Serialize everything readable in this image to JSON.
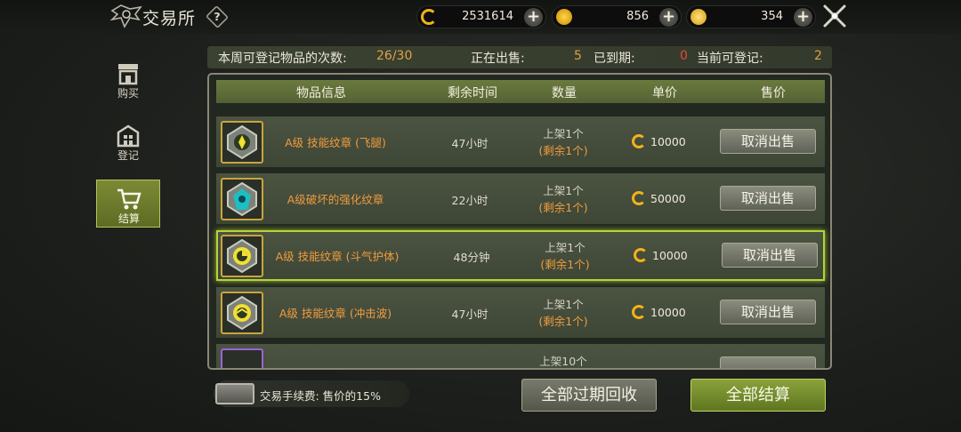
{
  "header": {
    "title": "交易所",
    "help_label": "?",
    "currencies": [
      {
        "name": "coin-currency",
        "value": "2531614",
        "add_label": "+"
      },
      {
        "name": "gold-currency",
        "value": "856",
        "add_label": "+"
      },
      {
        "name": "gem-currency",
        "value": "354",
        "add_label": "+"
      }
    ]
  },
  "sidebar": {
    "items": [
      {
        "label": "购买",
        "icon": "shop-icon"
      },
      {
        "label": "登记",
        "icon": "register-icon"
      },
      {
        "label": "结算",
        "icon": "cart-icon",
        "active": true
      }
    ]
  },
  "stats": {
    "weekly_label": "本周可登记物品的次数:",
    "weekly_value": "26/30",
    "selling_label": "正在出售:",
    "selling_value": "5",
    "expired_label": "已到期:",
    "expired_value": "0",
    "registerable_label": "当前可登记:",
    "registerable_value": "2"
  },
  "table": {
    "headers": [
      "物品信息",
      "剩余时间",
      "数量",
      "单价",
      "售价"
    ],
    "rows": [
      {
        "name": "A级 技能纹章 (飞腿)",
        "time": "47小时",
        "qty": "上架1个",
        "remain": "(剩余1个)",
        "price": "10000",
        "action": "取消出售",
        "icon": "emblem-icon"
      },
      {
        "name": "A级破坏的强化纹章",
        "time": "22小时",
        "qty": "上架1个",
        "remain": "(剩余1个)",
        "price": "50000",
        "action": "取消出售",
        "icon": "emblem-icon"
      },
      {
        "name": "A级 技能纹章 (斗气护体)",
        "time": "48分钟",
        "qty": "上架1个",
        "remain": "(剩余1个)",
        "price": "10000",
        "action": "取消出售",
        "icon": "emblem-icon"
      },
      {
        "name": "A级 技能纹章 (冲击波)",
        "time": "47小时",
        "qty": "上架1个",
        "remain": "(剩余1个)",
        "price": "10000",
        "action": "取消出售",
        "icon": "emblem-icon"
      },
      {
        "name": "",
        "time": "",
        "qty": "上架10个",
        "remain": "",
        "price": "",
        "action": "",
        "icon": "emblem-icon"
      }
    ]
  },
  "footer": {
    "fee_text": "交易手续费: 售价的15%",
    "expired_button": "全部过期回收",
    "settle_button": "全部结算"
  },
  "colors": {
    "accent_green": "#8aa23a",
    "orange_text": "#ef9c3d",
    "selected_border": "#b7d33a"
  }
}
